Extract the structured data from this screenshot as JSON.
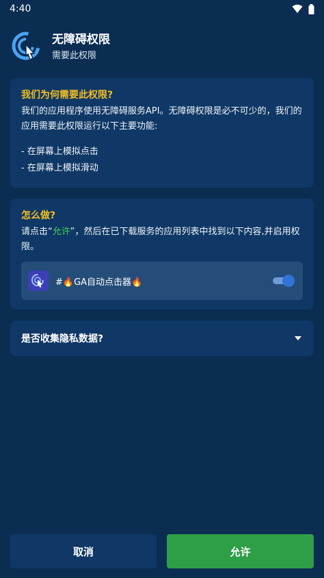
{
  "status_bar": {
    "time": "4:40"
  },
  "header": {
    "title": "无障碍权限",
    "subtitle": "需要此权限"
  },
  "why_card": {
    "title": "我们为何需要此权限?",
    "body": "我们的应用程序使用无障碍服务API。无障碍权限是必不可少的，我们的应用需要此权限运行以下主要功能:",
    "bullets": [
      "- 在屏幕上模拟点击",
      "- 在屏幕上模拟滑动"
    ]
  },
  "how_card": {
    "title": "怎么做?",
    "body_prefix": "请点击“",
    "body_highlight": "允许",
    "body_suffix": "”，然后在已下载服务的应用列表中找到以下内容,并启用权限。",
    "service_label": "#🔥GA自动点击器🔥",
    "toggle_state": "on"
  },
  "privacy_card": {
    "label": "是否收集隐私数据?"
  },
  "buttons": {
    "cancel": "取消",
    "allow": "允许"
  },
  "colors": {
    "background": "#0b2d52",
    "card": "#0f3866",
    "title_accent": "#f3bc23",
    "highlight_green": "#3fcf5a",
    "allow_button": "#2e9e47"
  }
}
